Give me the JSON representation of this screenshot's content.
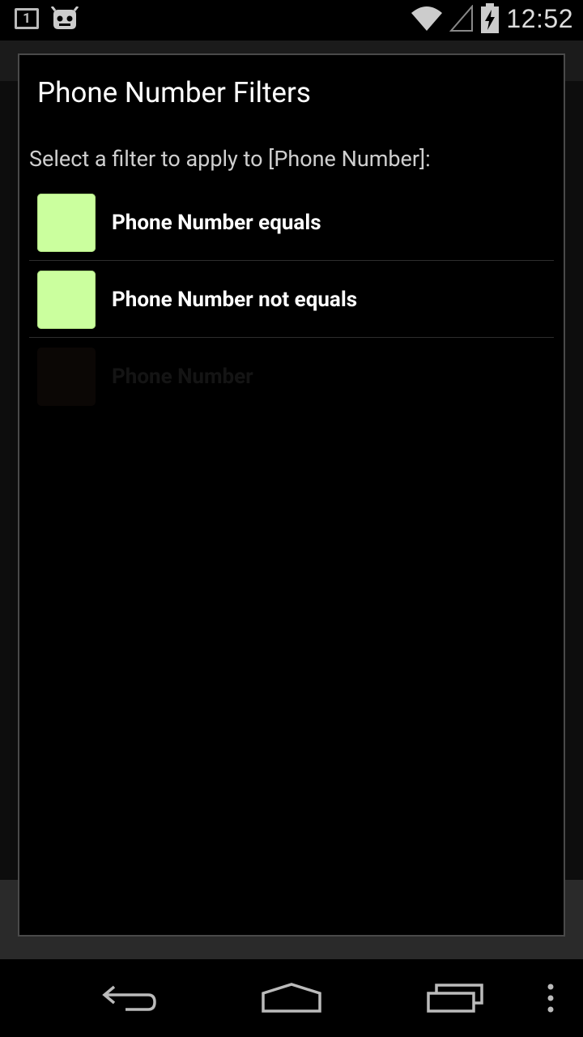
{
  "status_bar": {
    "notification_count": "1",
    "time": "12:52",
    "icons": [
      "notification-count-icon",
      "cyanogenmod-icon",
      "wifi-icon",
      "cell-signal-icon",
      "battery-charging-icon"
    ]
  },
  "dialog": {
    "title": "Phone Number Filters",
    "message": "Select a filter to apply to [Phone Number]:",
    "options": [
      {
        "label": "Phone Number equals",
        "color": "#cbff9e",
        "enabled": true
      },
      {
        "label": "Phone Number not equals",
        "color": "#cbff9e",
        "enabled": true
      },
      {
        "label": "Phone Number",
        "color": "#0b0705",
        "enabled": false
      }
    ]
  },
  "navigation_bar": {
    "icons": [
      "back-icon",
      "home-icon",
      "recent-apps-icon",
      "overflow-menu-icon"
    ]
  }
}
